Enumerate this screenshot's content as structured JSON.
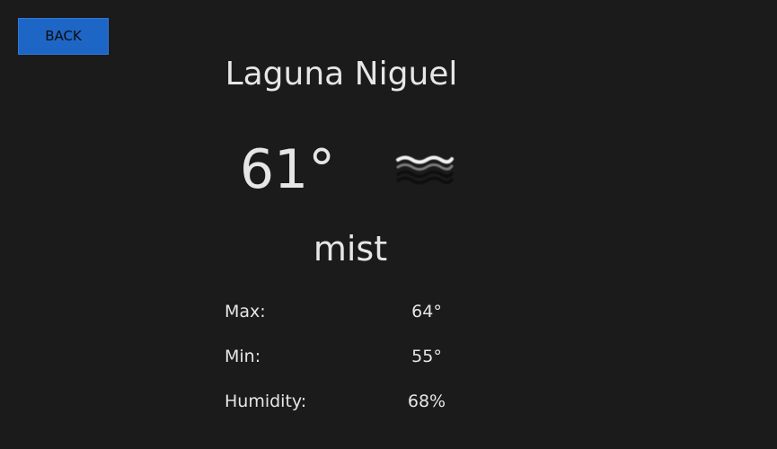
{
  "back_label": "BACK",
  "city": "Laguna Niguel",
  "temperature": "61°",
  "condition_icon": "mist-icon",
  "condition": "mist",
  "stats": [
    {
      "label": "Max:",
      "value": "64°"
    },
    {
      "label": "Min:",
      "value": "55°"
    },
    {
      "label": "Humidity:",
      "value": "68%"
    }
  ],
  "colors": {
    "background": "#1b1b1b",
    "button": "#1e66c6",
    "text": "#e6e6e6"
  }
}
